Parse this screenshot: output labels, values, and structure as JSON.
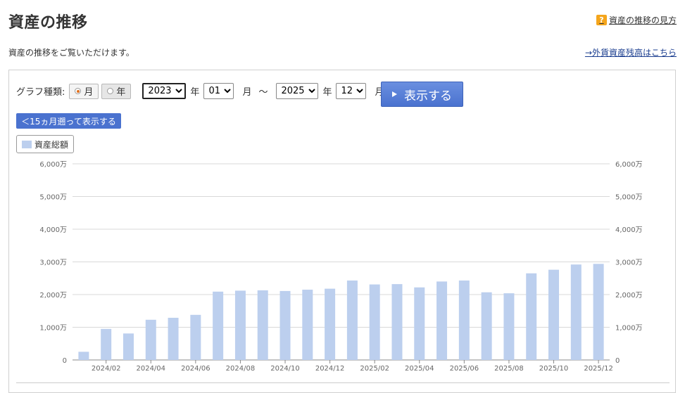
{
  "header": {
    "title": "資産の推移",
    "help_link": "資産の推移の見方",
    "help_icon_glyph": "?"
  },
  "description": "資産の推移をご覧いただけます。",
  "foreign_link": "→外貨資産残高はこちら",
  "controls": {
    "graph_type_label": "グラフ種類:",
    "monthly_label": "月",
    "yearly_label": "年",
    "selected_type": "monthly",
    "start_year": "2023",
    "start_month": "01",
    "end_year": "2025",
    "end_month": "12",
    "year_unit": "年",
    "month_unit": "月",
    "range_separator": "～",
    "show_button": "表示する",
    "back_button": "＜15ヵ月遡って表示する"
  },
  "colors": {
    "bar": "#bccfee",
    "accent": "#4a72cf",
    "grid": "#d9d9d9",
    "tick_text": "#666666"
  },
  "chart_data": {
    "type": "bar",
    "series": [
      {
        "name": "資産総額",
        "values": [
          250,
          950,
          810,
          1230,
          1290,
          1380,
          2090,
          2120,
          2130,
          2110,
          2150,
          2180,
          2430,
          2310,
          2320,
          2220,
          2400,
          2430,
          2070,
          2040,
          2650,
          2760,
          2920,
          2940
        ]
      }
    ],
    "categories": [
      "2024/01",
      "2024/02",
      "2024/03",
      "2024/04",
      "2024/05",
      "2024/06",
      "2024/07",
      "2024/08",
      "2024/09",
      "2024/10",
      "2024/11",
      "2024/12",
      "2025/01",
      "2025/02",
      "2025/03",
      "2025/04",
      "2025/05",
      "2025/06",
      "2025/07",
      "2025/08",
      "2025/09",
      "2025/10",
      "2025/11",
      "2025/12"
    ],
    "x_tick_labels": [
      "2024/02",
      "2024/04",
      "2024/06",
      "2024/08",
      "2024/10",
      "2024/12",
      "2025/02",
      "2025/04",
      "2025/06",
      "2025/08",
      "2025/10",
      "2025/12"
    ],
    "y_ticks": [
      0,
      1000,
      2000,
      3000,
      4000,
      5000,
      6000
    ],
    "y_tick_labels": [
      "0",
      "1,000万",
      "2,000万",
      "3,000万",
      "4,000万",
      "5,000万",
      "6,000万"
    ],
    "ylim": [
      0,
      6000
    ],
    "y_unit": "万円",
    "grid": true,
    "legend_position": "top-left",
    "secondary_y_axis": true
  }
}
